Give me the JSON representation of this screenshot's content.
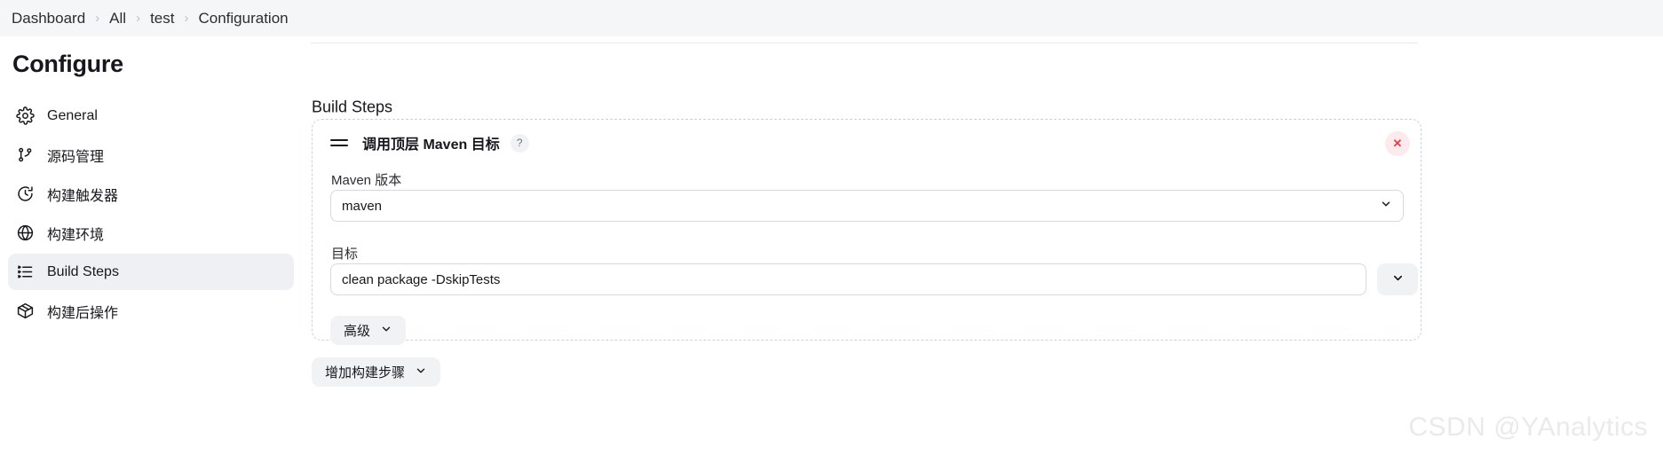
{
  "breadcrumb": {
    "separator": "›",
    "items": [
      {
        "label": "Dashboard"
      },
      {
        "label": "All"
      },
      {
        "label": "test"
      },
      {
        "label": "Configuration"
      }
    ]
  },
  "sidebar": {
    "title": "Configure",
    "items": [
      {
        "label": "General",
        "icon": "gear-icon",
        "active": false
      },
      {
        "label": "源码管理",
        "icon": "source-control-icon",
        "active": false
      },
      {
        "label": "构建触发器",
        "icon": "clock-icon",
        "active": false
      },
      {
        "label": "构建环境",
        "icon": "globe-icon",
        "active": false
      },
      {
        "label": "Build Steps",
        "icon": "list-icon",
        "active": true
      },
      {
        "label": "构建后操作",
        "icon": "package-icon",
        "active": false
      }
    ]
  },
  "main": {
    "section_title": "Build Steps",
    "step": {
      "title": "调用顶层 Maven 目标",
      "drag_handle_icon": "drag-handle-icon",
      "help_label": "?",
      "close_label": "✕",
      "version_label": "Maven 版本",
      "version_value": "maven",
      "version_options": [
        "maven"
      ],
      "goals_label": "目标",
      "goals_value": "clean package -DskipTests",
      "goals_placeholder": "",
      "goals_dropdown_icon": "chevron-down-icon",
      "advanced_label": "高级"
    },
    "add_step_label": "增加构建步骤"
  },
  "watermark": "CSDN @YAnalytics",
  "colors": {
    "breadcrumb_bg": "#f5f6f7",
    "active_nav_bg": "#eef0f3",
    "dashed_border": "#c9d3de",
    "close_bg": "#fdeaec",
    "close_fg": "#e23c45",
    "pill_bg": "#f1f2f4",
    "watermark": "#e8eaec"
  }
}
